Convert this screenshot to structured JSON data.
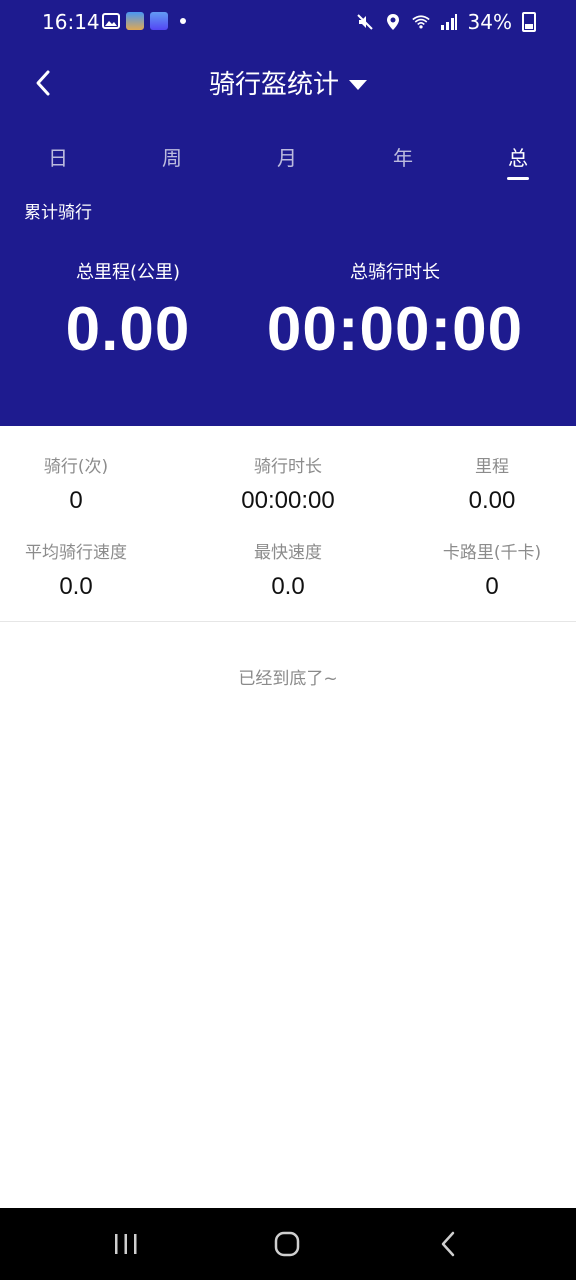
{
  "status_bar": {
    "time": "16:14",
    "battery": "34%"
  },
  "header": {
    "title": "骑行盔统计"
  },
  "tabs": [
    {
      "label": "日"
    },
    {
      "label": "周"
    },
    {
      "label": "月"
    },
    {
      "label": "年"
    },
    {
      "label": "总",
      "active": true
    }
  ],
  "summary": {
    "section_label": "累计骑行",
    "total_distance_label": "总里程(公里)",
    "total_distance_value": "0.00",
    "total_duration_label": "总骑行时长",
    "total_duration_value": "00:00:00"
  },
  "stats": [
    {
      "label": "骑行(次)",
      "value": "0"
    },
    {
      "label": "骑行时长",
      "value": "00:00:00"
    },
    {
      "label": "里程",
      "value": "0.00"
    },
    {
      "label": "平均骑行速度",
      "value": "0.0"
    },
    {
      "label": "最快速度",
      "value": "0.0"
    },
    {
      "label": "卡路里(千卡)",
      "value": "0"
    }
  ],
  "end_note": "已经到底了~",
  "colors": {
    "header_bg": "#1e1b8f",
    "accent_text": "#ffffff",
    "muted_text": "#8c8c8c"
  },
  "icons": {
    "back": "back-arrow-icon",
    "dropdown": "caret-down-icon",
    "nav_recents": "recents-icon",
    "nav_home": "home-icon",
    "nav_back": "nav-back-icon"
  }
}
